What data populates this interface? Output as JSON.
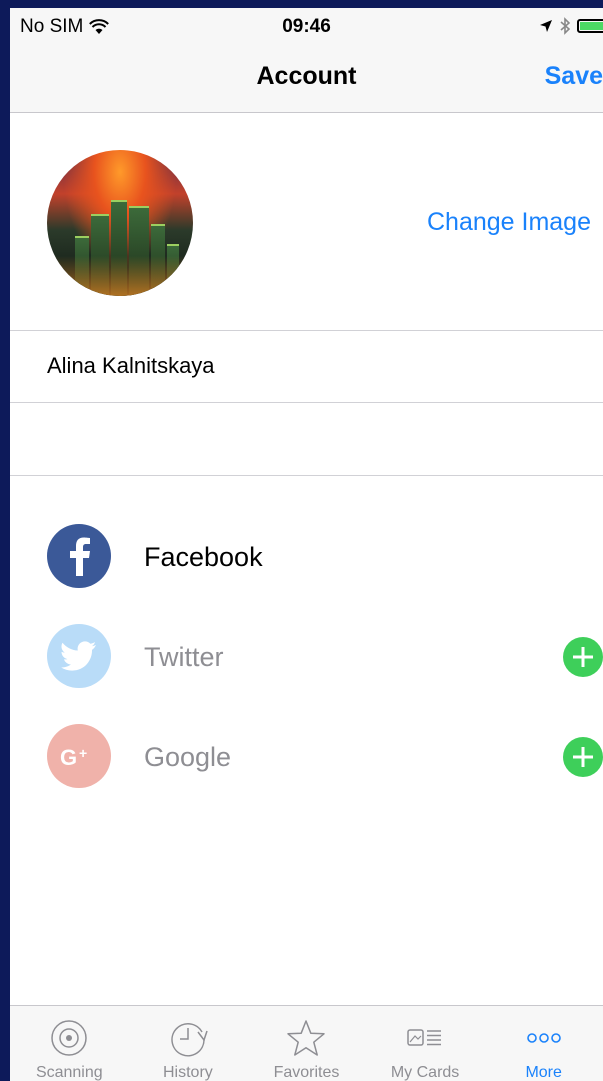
{
  "status_bar": {
    "carrier": "No SIM",
    "time": "09:46"
  },
  "nav": {
    "title": "Account",
    "save_label": "Save"
  },
  "profile": {
    "change_image_label": "Change Image",
    "name": "Alina Kalnitskaya"
  },
  "social": [
    {
      "label": "Facebook",
      "icon": "facebook-icon",
      "color": "#3b5998",
      "connected": true
    },
    {
      "label": "Twitter",
      "icon": "twitter-icon",
      "color": "#b9dcf8",
      "connected": false
    },
    {
      "label": "Google",
      "icon": "google-plus-icon",
      "color": "#f0b2aa",
      "connected": false
    }
  ],
  "tabs": [
    {
      "label": "Scanning",
      "icon": "scan-icon"
    },
    {
      "label": "History",
      "icon": "history-icon"
    },
    {
      "label": "Favorites",
      "icon": "star-icon"
    },
    {
      "label": "My Cards",
      "icon": "cards-icon"
    },
    {
      "label": "More",
      "icon": "more-icon",
      "active": true
    }
  ],
  "colors": {
    "accent": "#1a82fb",
    "add": "#3ecf5a",
    "inactive_tab": "#8e8e93"
  }
}
